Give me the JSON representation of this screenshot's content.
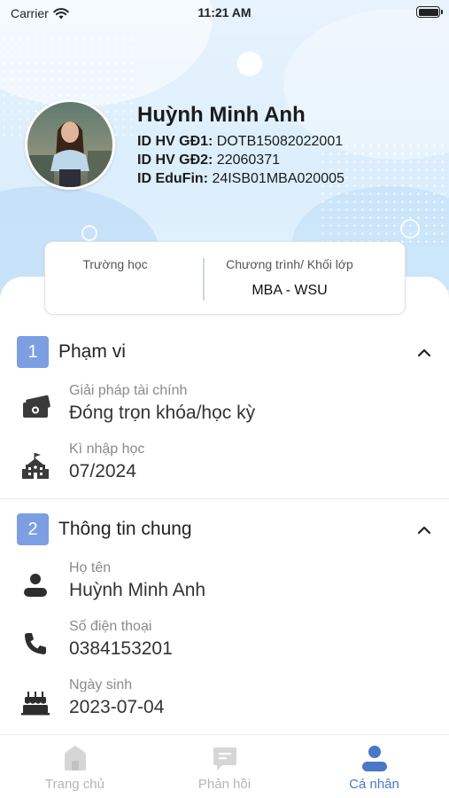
{
  "status_bar": {
    "carrier": "Carrier",
    "time": "11:21 AM"
  },
  "profile": {
    "name": "Huỳnh Minh Anh",
    "ids": [
      {
        "label": "ID HV GĐ1:",
        "value": "DOTB15082022001"
      },
      {
        "label": "ID HV GĐ2:",
        "value": "22060371"
      },
      {
        "label": "ID EduFin:",
        "value": "24ISB01MBA020005"
      }
    ]
  },
  "summary_card": {
    "school_label": "Trường học",
    "school_value": "",
    "program_label": "Chương trình/ Khối lớp",
    "program_value": "MBA - WSU"
  },
  "sections": {
    "scope": {
      "number": "1",
      "title": "Phạm vi",
      "fields": [
        {
          "label": "Giải pháp tài chính",
          "value": "Đóng trọn khóa/học kỳ",
          "icon": "money-icon"
        },
        {
          "label": "Kì nhập học",
          "value": "07/2024",
          "icon": "school-building-icon"
        }
      ]
    },
    "general": {
      "number": "2",
      "title": "Thông tin chung",
      "fields": [
        {
          "label": "Họ tên",
          "value": "Huỳnh Minh Anh",
          "icon": "person-icon"
        },
        {
          "label": "Số điện thoại",
          "value": "0384153201",
          "icon": "phone-icon"
        },
        {
          "label": "Ngày sinh",
          "value": "2023-07-04",
          "icon": "birthday-cake-icon"
        }
      ]
    }
  },
  "tabbar": {
    "items": [
      {
        "label": "Trang chủ",
        "icon": "home-icon",
        "active": false
      },
      {
        "label": "Phản hồi",
        "icon": "feedback-icon",
        "active": false
      },
      {
        "label": "Cá nhân",
        "icon": "profile-icon",
        "active": true
      }
    ]
  },
  "colors": {
    "accent": "#4a78c9",
    "section_badge": "#7c9ee3",
    "hero_bg": "#dbeefc"
  }
}
